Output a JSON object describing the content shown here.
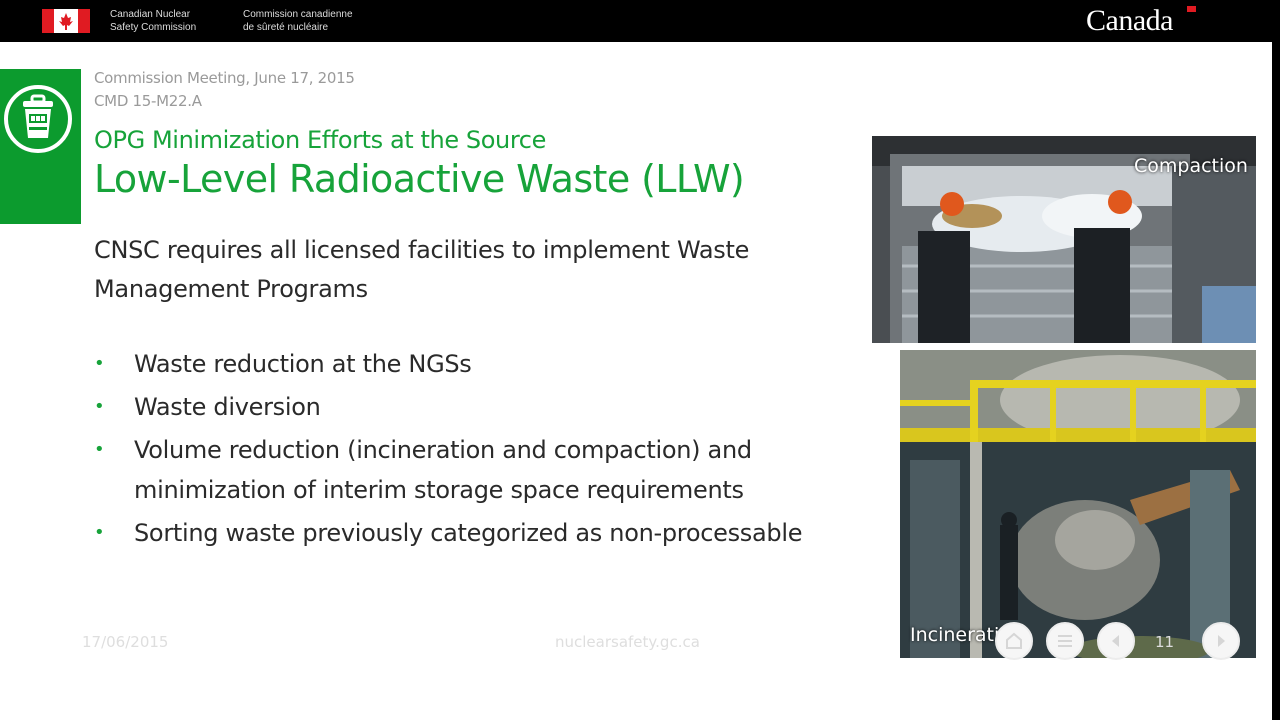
{
  "header": {
    "org_en_line1": "Canadian Nuclear",
    "org_en_line2": "Safety Commission",
    "org_fr_line1": "Commission canadienne",
    "org_fr_line2": "de sûreté nucléaire",
    "wordmark": "Canada",
    "flag_icon": "canada-flag-icon"
  },
  "slide": {
    "meeting": "Commission Meeting, June 17, 2015",
    "cmd": "CMD 15-M22.A",
    "subtitle": "OPG Minimization Efforts at the Source",
    "title": "Low-Level Radioactive Waste (LLW)",
    "intro": "CNSC requires all licensed facilities to implement Waste Management Programs",
    "bullets": [
      "Waste reduction at the NGSs",
      "Waste diversion",
      "Volume reduction (incineration and compaction) and minimization of interim storage space requirements",
      "Sorting waste previously categorized as non-processable"
    ],
    "bullet_marker": "•",
    "section_icon": "waste-bin-icon",
    "accent_color": "#0c9b2e"
  },
  "photos": {
    "compaction_label": "Compaction",
    "incineration_label": "Incineration"
  },
  "footer": {
    "date": "17/06/2015",
    "site": "nuclearsafety.gc.ca",
    "page": "11",
    "home_icon": "home-icon",
    "menu_icon": "menu-list-icon",
    "prev_icon": "previous-arrow-icon",
    "next_icon": "next-arrow-icon"
  }
}
